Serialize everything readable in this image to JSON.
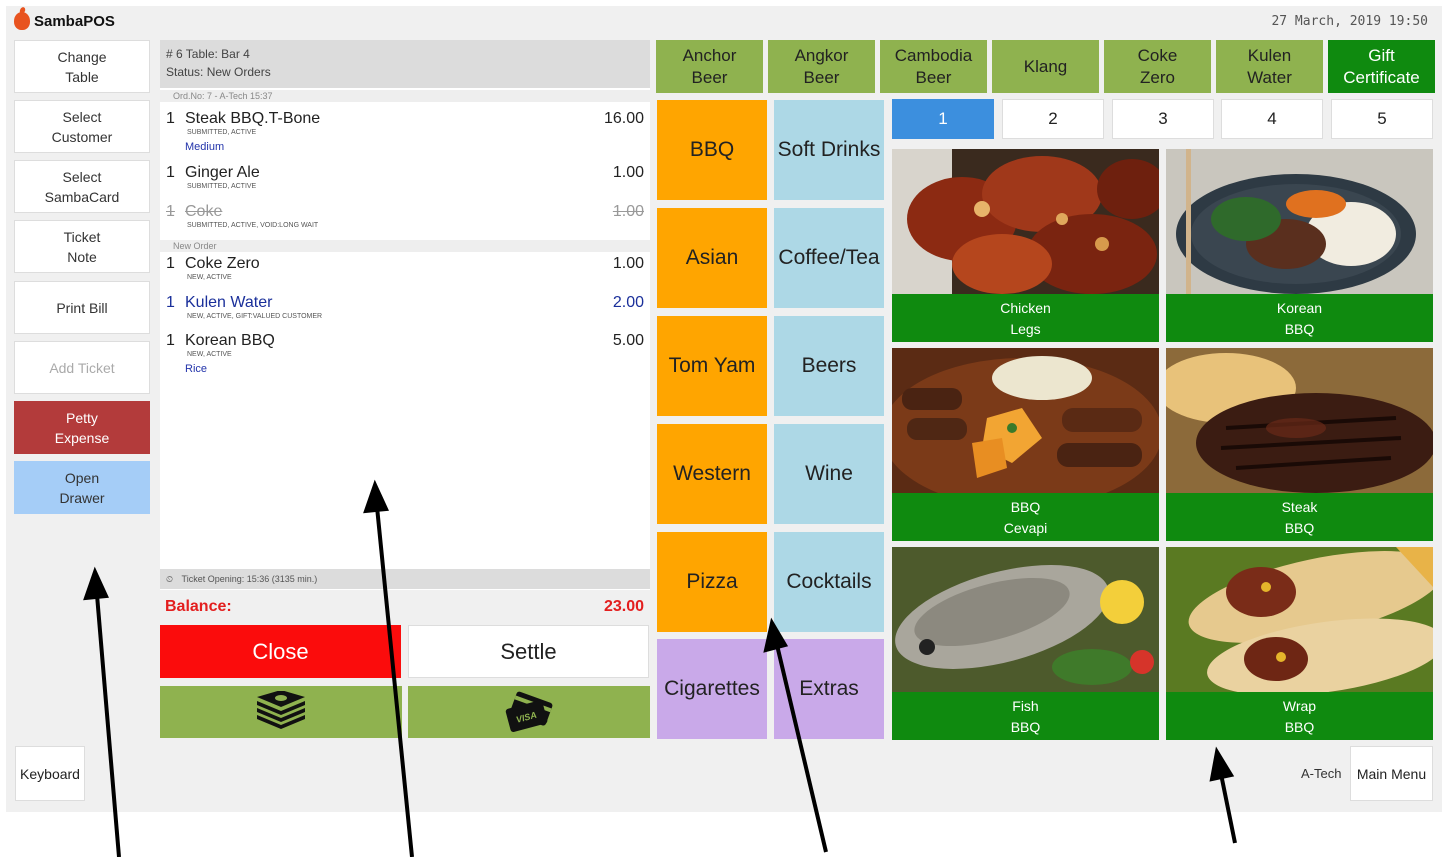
{
  "app": {
    "name": "SambaPOS",
    "datetime": "27 March, 2019 19:50",
    "user": "A-Tech"
  },
  "left_buttons": [
    {
      "label": "Change\nTable",
      "state": "normal"
    },
    {
      "label": "Select\nCustomer",
      "state": "normal"
    },
    {
      "label": "Select\nSambaCard",
      "state": "normal"
    },
    {
      "label": "Ticket\nNote",
      "state": "normal"
    },
    {
      "label": "Print Bill",
      "state": "normal"
    },
    {
      "label": "Add Ticket",
      "state": "disabled"
    },
    {
      "label": "Petty\nExpense",
      "state": "petty"
    },
    {
      "label": "Open\nDrawer",
      "state": "drawer"
    }
  ],
  "ticket": {
    "header_line1": "# 6 Table: Bar 4",
    "header_line2": "Status: New Orders",
    "group1_label": "Ord.No: 7 - A-Tech 15:37",
    "group2_label": "New Order",
    "orders": [
      {
        "qty": "1",
        "name": "Steak BBQ.T-Bone",
        "price": "16.00",
        "states": "SUBMITTED, ACTIVE",
        "extra": "Medium",
        "style": "normal"
      },
      {
        "qty": "1",
        "name": "Ginger Ale",
        "price": "1.00",
        "states": "SUBMITTED, ACTIVE",
        "extra": "",
        "style": "normal"
      },
      {
        "qty": "1",
        "name": "Coke",
        "price": "1.00",
        "states": "SUBMITTED, ACTIVE, VOID:LONG WAIT",
        "extra": "",
        "style": "void"
      },
      {
        "qty": "1",
        "name": "Coke Zero",
        "price": "1.00",
        "states": "NEW, ACTIVE",
        "extra": "",
        "style": "normal"
      },
      {
        "qty": "1",
        "name": "Kulen Water",
        "price": "2.00",
        "states": "NEW, ACTIVE, GIFT:VALUED CUSTOMER",
        "extra": "",
        "style": "gift"
      },
      {
        "qty": "1",
        "name": "Korean BBQ",
        "price": "5.00",
        "states": "NEW, ACTIVE",
        "extra": "Rice",
        "style": "normal"
      }
    ],
    "footer": "Ticket Opening:  15:36 (3135 min.)",
    "balance_label": "Balance:",
    "balance_value": "23.00"
  },
  "actions": {
    "close": "Close",
    "settle": "Settle"
  },
  "payment_icons": [
    "cash-icon",
    "credit-card-icon"
  ],
  "quick_products": [
    {
      "label": "Anchor\nBeer",
      "style": "green"
    },
    {
      "label": "Angkor\nBeer",
      "style": "green"
    },
    {
      "label": "Cambodia\nBeer",
      "style": "green"
    },
    {
      "label": "Klang",
      "style": "green"
    },
    {
      "label": "Coke\nZero",
      "style": "green"
    },
    {
      "label": "Kulen\nWater",
      "style": "green"
    },
    {
      "label": "Gift\nCertificate",
      "style": "darkgreen"
    }
  ],
  "categories": [
    {
      "label": "BBQ",
      "color": "orange"
    },
    {
      "label": "Soft Drinks",
      "color": "blue"
    },
    {
      "label": "Asian",
      "color": "orange"
    },
    {
      "label": "Coffee/Tea",
      "color": "blue"
    },
    {
      "label": "Tom Yam",
      "color": "orange"
    },
    {
      "label": "Beers",
      "color": "blue"
    },
    {
      "label": "Western",
      "color": "orange"
    },
    {
      "label": "Wine",
      "color": "blue"
    },
    {
      "label": "Pizza",
      "color": "orange"
    },
    {
      "label": "Cocktails",
      "color": "blue"
    },
    {
      "label": "Cigarettes",
      "color": "purple"
    },
    {
      "label": "Extras",
      "color": "purple"
    }
  ],
  "pages": [
    "1",
    "2",
    "3",
    "4",
    "5"
  ],
  "active_page": "1",
  "menu_items": [
    {
      "label": "Chicken\nLegs"
    },
    {
      "label": "Korean\nBBQ"
    },
    {
      "label": "BBQ\nCevapi"
    },
    {
      "label": "Steak\nBBQ"
    },
    {
      "label": "Fish\nBBQ"
    },
    {
      "label": "Wrap\nBBQ"
    }
  ],
  "bottom": {
    "keyboard": "Keyboard",
    "main_menu": "Main Menu"
  },
  "colors": {
    "orange": "#ffa500",
    "blue": "#add8e6",
    "purple": "#c9a9e9",
    "green": "#8fb24f",
    "darkgreen": "#0f8a0f",
    "active_page": "#3c8fde",
    "close": "#fb0c0c",
    "petty": "#b33b3b",
    "drawer": "#a5cdf7"
  }
}
